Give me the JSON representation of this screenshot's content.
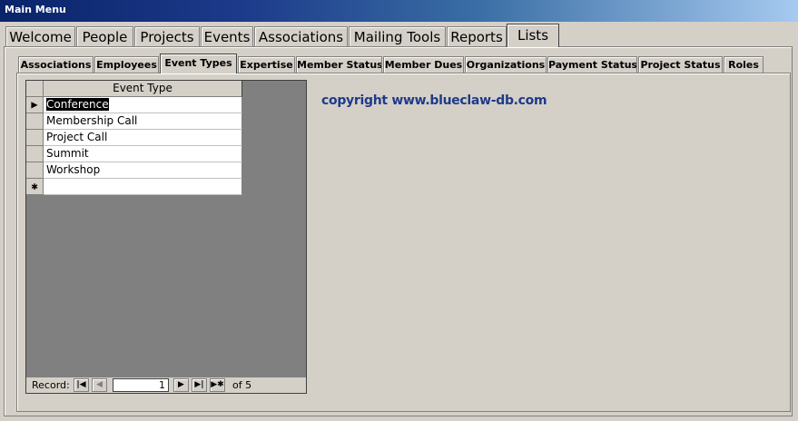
{
  "window": {
    "title": "Main Menu"
  },
  "main_tabs": [
    {
      "label": "Welcome"
    },
    {
      "label": "People"
    },
    {
      "label": "Projects"
    },
    {
      "label": "Events"
    },
    {
      "label": "Associations"
    },
    {
      "label": "Mailing Tools"
    },
    {
      "label": "Reports"
    },
    {
      "label": "Lists"
    }
  ],
  "main_tabs_active": "Lists",
  "sub_tabs": [
    {
      "label": "Associations"
    },
    {
      "label": "Employees"
    },
    {
      "label": "Event Types"
    },
    {
      "label": "Expertise"
    },
    {
      "label": "Member Status"
    },
    {
      "label": "Member Dues"
    },
    {
      "label": "Organizations"
    },
    {
      "label": "Payment Status"
    },
    {
      "label": "Project Status"
    },
    {
      "label": "Roles"
    }
  ],
  "sub_tabs_active": "Event Types",
  "datasheet": {
    "column_header": "Event Type",
    "rows": [
      {
        "selector": "▶",
        "value": "Conference"
      },
      {
        "selector": "",
        "value": "Membership Call"
      },
      {
        "selector": "",
        "value": "Project Call"
      },
      {
        "selector": "",
        "value": "Summit"
      },
      {
        "selector": "",
        "value": "Workshop"
      },
      {
        "selector": "✱",
        "value": ""
      }
    ],
    "record_nav": {
      "label": "Record:",
      "current": "1",
      "of_text": "of  5",
      "first_icon": "first-record-icon",
      "prev_icon": "previous-record-icon",
      "next_icon": "next-record-icon",
      "last_icon": "last-record-icon",
      "new_icon": "new-record-icon"
    }
  },
  "copyright": "copyright www.blueclaw-db.com",
  "colors": {
    "title_bar_start": "#0a246a",
    "title_bar_end": "#a6caf0",
    "copyright_text": "#1f3a8a",
    "datasheet_bg": "#808080"
  }
}
